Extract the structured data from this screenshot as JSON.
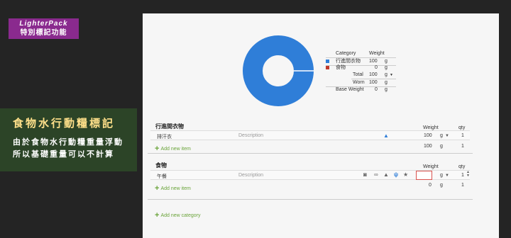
{
  "banners": {
    "top_line1": "LighterPack",
    "top_line2": "特別標記功能",
    "mid_title": "食物水行動糧標記",
    "mid_body_line1": "由於食物水行動糧重量浮動",
    "mid_body_line2": "所以基礎重量可以不計算"
  },
  "chart_data": {
    "type": "pie",
    "style": "donut",
    "categories": [
      "行進間衣物",
      "食物"
    ],
    "values": [
      100,
      0
    ],
    "colors": [
      "#2f7ed8",
      "#c0392b"
    ]
  },
  "summary": {
    "col_category": "Category",
    "col_weight": "Weight",
    "rows": [
      {
        "name": "行進間衣物",
        "value": "100",
        "unit": "g",
        "color": "#2f7ed8"
      },
      {
        "name": "食物",
        "value": "0",
        "unit": "g",
        "color": "#c0392b"
      }
    ],
    "total_label": "Total",
    "total_value": "100",
    "total_unit": "g",
    "worn_label": "Worn",
    "worn_value": "100",
    "worn_unit": "g",
    "base_label": "Base Weight",
    "base_value": "0",
    "base_unit": "g"
  },
  "categories": [
    {
      "title": "行進間衣物",
      "col_weight": "Weight",
      "col_qty": "qty",
      "item_name": "排汗衣",
      "item_desc": "Description",
      "item_weight": "100",
      "item_unit": "g",
      "item_qty": "1",
      "add_label": "Add new item",
      "subtotal_weight": "100",
      "subtotal_unit": "g",
      "subtotal_qty": "1"
    },
    {
      "title": "食物",
      "col_weight": "Weight",
      "col_qty": "qty",
      "item_name": "午餐",
      "item_desc": "Description",
      "item_weight": "",
      "item_unit": "g",
      "item_qty": "1",
      "add_label": "Add new item",
      "subtotal_weight": "0",
      "subtotal_unit": "g",
      "subtotal_qty": "1"
    }
  ],
  "add_category_label": "Add new category",
  "icons": [
    "camera-icon",
    "link-icon",
    "worn-shirt-icon",
    "consumable-food-icon",
    "star-icon"
  ]
}
